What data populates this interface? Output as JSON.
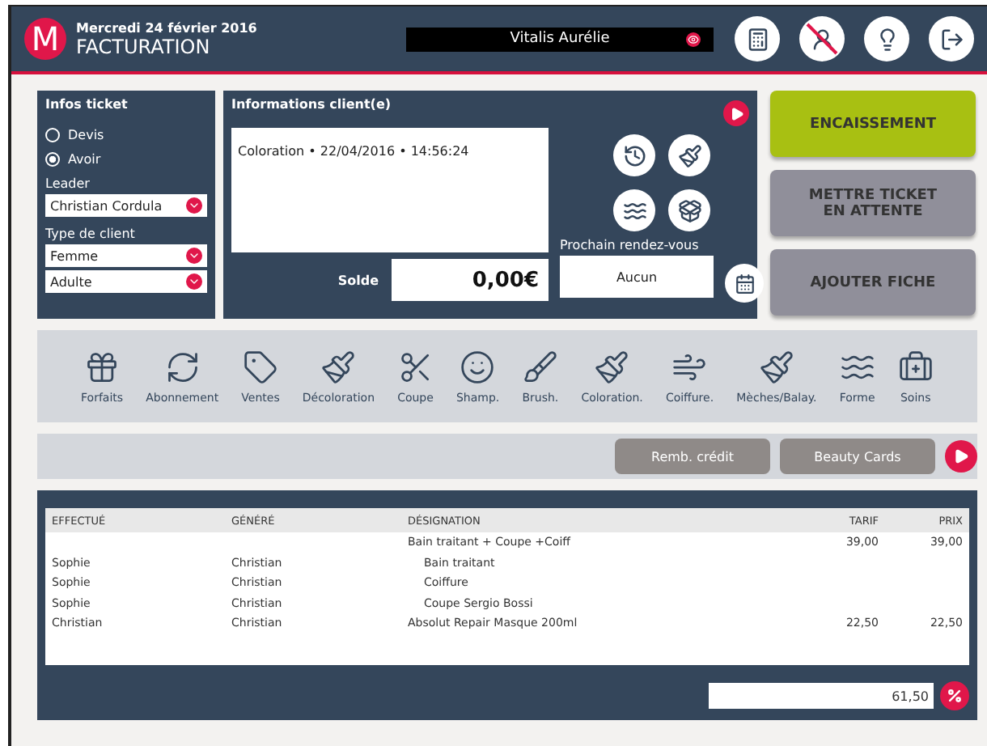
{
  "header": {
    "logo": "M",
    "date": "Mercredi 24 février 2016",
    "title": "FACTURATION",
    "client_name": "Vitalis Aurélie"
  },
  "ticket": {
    "title": "Infos ticket",
    "options": [
      {
        "label": "Devis",
        "selected": false
      },
      {
        "label": "Avoir",
        "selected": true
      }
    ],
    "leader_label": "Leader",
    "leader": "Christian Cordula",
    "client_type_label": "Type de client",
    "client_type": "Femme",
    "age": "Adulte"
  },
  "client_info": {
    "title": "Informations client(e)",
    "history": "Coloration • 22/04/2016 • 14:56:24",
    "balance_label": "Solde",
    "balance": "0,00€",
    "next_label": "Prochain rendez-vous",
    "next": "Aucun"
  },
  "actions": [
    {
      "label": "ENCAISSEMENT",
      "kind": "primary"
    },
    {
      "label": "METTRE TICKET EN ATTENTE",
      "kind": "secondary"
    },
    {
      "label": "AJOUTER FICHE",
      "kind": "secondary"
    }
  ],
  "services": [
    "Forfaits",
    "Abonnement",
    "Ventes",
    "Décoloration",
    "Coupe",
    "Shamp.",
    "Brush.",
    "Coloration.",
    "Coiffure.",
    "Mèches/Balay.",
    "Forme",
    "Soins"
  ],
  "extra_buttons": [
    "Remb. crédit",
    "Beauty Cards"
  ],
  "table": {
    "columns": [
      "EFFECTUÉ",
      "GÉNÉRÉ",
      "DÉSIGNATION",
      "TARIF",
      "PRIX"
    ],
    "rows": [
      {
        "cells": [
          "",
          "",
          "Bain traitant + Coupe +Coiff",
          "39,00",
          "39,00"
        ],
        "children": [
          {
            "cells": [
              "Sophie",
              "Christian",
              "Bain traitant",
              "",
              ""
            ]
          },
          {
            "cells": [
              "Sophie",
              "Christian",
              "Coiffure",
              "",
              ""
            ]
          },
          {
            "cells": [
              "Sophie",
              "Christian",
              "Coupe Sergio Bossi",
              "",
              ""
            ]
          }
        ]
      },
      {
        "cells": [
          "Christian",
          "Christian",
          "Absolut Repair Masque 200ml",
          "22,50",
          "22,50"
        ]
      }
    ]
  },
  "total": "61,50"
}
